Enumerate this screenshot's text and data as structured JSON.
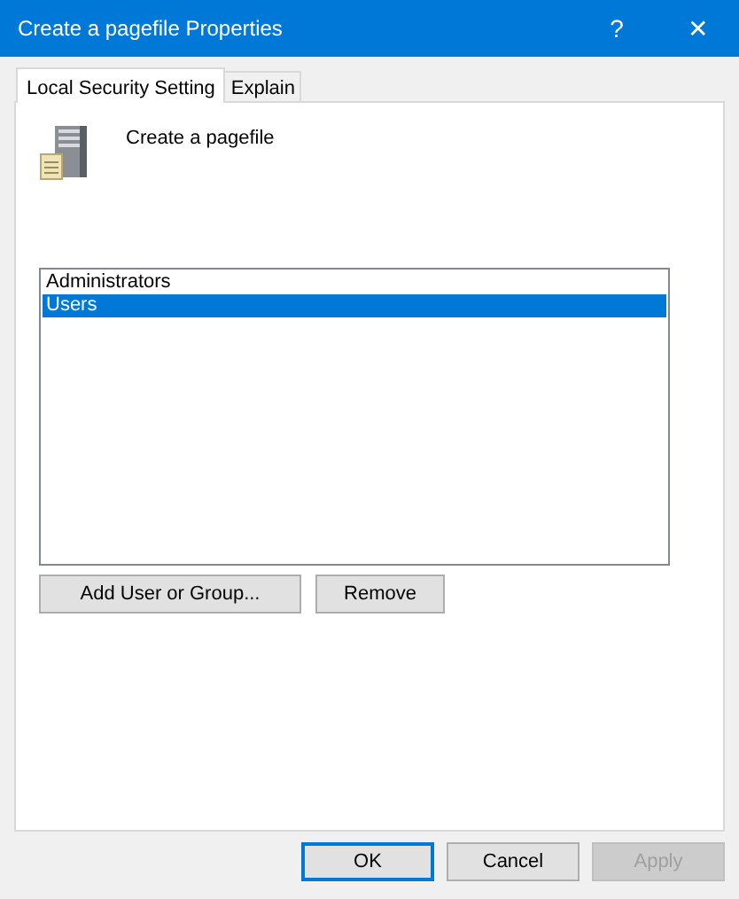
{
  "window": {
    "title": "Create a pagefile Properties",
    "help": "?",
    "close": "✕"
  },
  "tabs": [
    {
      "label": "Local Security Setting",
      "selected": true
    },
    {
      "label": "Explain",
      "selected": false
    }
  ],
  "policy": {
    "name": "Create a pagefile"
  },
  "accounts": [
    {
      "name": "Administrators",
      "selected": false
    },
    {
      "name": "Users",
      "selected": true
    }
  ],
  "list_buttons": [
    {
      "label": "Add User or Group...",
      "disabled": false
    },
    {
      "label": "Remove",
      "disabled": false
    }
  ],
  "dialog_buttons": [
    {
      "label": "OK",
      "default": true,
      "disabled": false
    },
    {
      "label": "Cancel",
      "default": false,
      "disabled": false
    },
    {
      "label": "Apply",
      "default": false,
      "disabled": true
    }
  ]
}
